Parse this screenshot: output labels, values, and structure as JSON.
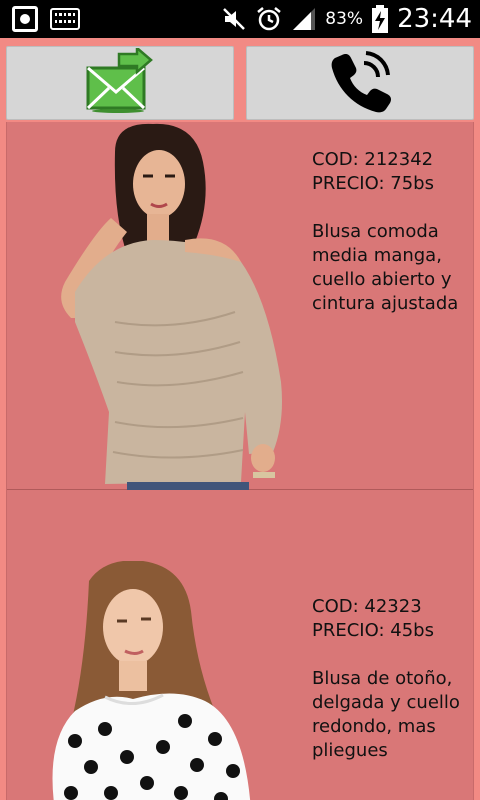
{
  "status_bar": {
    "battery": "83%",
    "time": "23:44",
    "icons": [
      "record-icon",
      "keyboard-icon",
      "mute-icon",
      "alarm-icon",
      "signal-icon",
      "battery-charging-icon"
    ]
  },
  "toolbar": {
    "email_icon": "email-send-icon",
    "phone_icon": "phone-call-icon"
  },
  "products": [
    {
      "code": "COD: 212342",
      "price": "PRECIO: 75bs",
      "description": "Blusa comoda media manga, cuello abierto y cintura ajustada",
      "image": "woman-beige-blouse"
    },
    {
      "code": "COD: 42323",
      "price": "PRECIO: 45bs",
      "description": "Blusa de otoño, delgada y cuello redondo, mas pliegues",
      "image": "woman-polka-dot-blouse"
    }
  ],
  "colors": {
    "background": "#f28a84",
    "list_background": "#d97777",
    "button_background": "#d6d6d6"
  }
}
